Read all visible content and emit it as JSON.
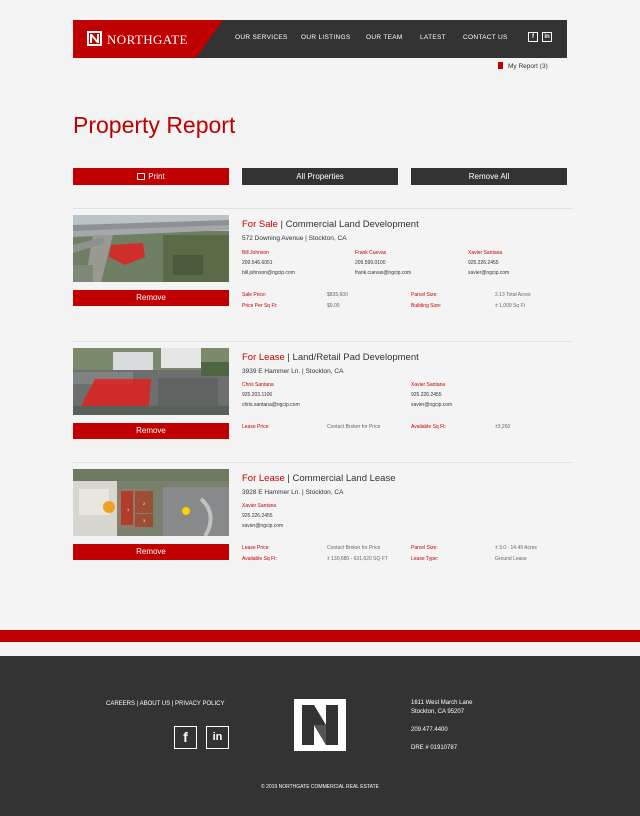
{
  "brand": {
    "name": "NORTHGATE",
    "red": "#c00000",
    "dark": "#333333"
  },
  "nav": {
    "items": [
      "OUR SERVICES",
      "OUR LISTINGS",
      "OUR TEAM",
      "LATEST",
      "CONTACT US"
    ],
    "social": [
      "f",
      "in"
    ]
  },
  "my_report": "My Report (3)",
  "page_title": "Property Report",
  "actions": {
    "print": "Print",
    "all_properties": "All Properties",
    "remove_all": "Remove All"
  },
  "properties": [
    {
      "status": "For Sale",
      "type": "Commercial Land Development",
      "address": "572 Downing Avenue | Stockton, CA",
      "agents": [
        {
          "name": "Bill Johnson",
          "phone": "209.546.6051",
          "email": "bill.johnson@ngcip.com"
        },
        {
          "name": "Frank Cuevas",
          "phone": "209.599.0100",
          "email": "frank.cuevas@ngcip.com"
        },
        {
          "name": "Xavier Santana",
          "phone": "925.226.2455",
          "email": "xavier@ngcip.com"
        }
      ],
      "details": [
        {
          "label": "Sale Price:",
          "value": "$835,600"
        },
        {
          "label": "Parcel Size:",
          "value": "2.13 Total Acres"
        },
        {
          "label": "Price Per Sq Ft:",
          "value": "$9.00"
        },
        {
          "label": "Building Size:",
          "value": "± 1,009 Sq Ft"
        }
      ],
      "remove": "Remove"
    },
    {
      "status": "For Lease",
      "type": "Land/Retail Pad Development",
      "address": "3939 E Hammer Ln. | Stockton, CA",
      "agents": [
        {
          "name": "Chris Santana",
          "phone": "925.203.1106",
          "email": "chris.santana@ngcip.com"
        },
        {
          "name": "Xavier Santana",
          "phone": "925.226.2455",
          "email": "xavier@ngcip.com"
        }
      ],
      "details": [
        {
          "label": "Lease Price:",
          "value": "Contact Broker for Price"
        },
        {
          "label": "Available Sq Ft:",
          "value": "±3,260"
        }
      ],
      "remove": "Remove"
    },
    {
      "status": "For Lease",
      "type": "Commercial Land Lease",
      "address": "3928 E Hammer Ln. | Stockton, CA",
      "agents": [
        {
          "name": "Xavier Santana",
          "phone": "925.226.2455",
          "email": "xavier@ngcip.com"
        }
      ],
      "details": [
        {
          "label": "Lease Price:",
          "value": "Contact Broker for Price"
        },
        {
          "label": "Parcel Size:",
          "value": "± 3.0 - 14.49 Acres"
        },
        {
          "label": "Available Sq Ft:",
          "value": "± 130,680 - 631,620 SQ FT"
        },
        {
          "label": "Lease Type:",
          "value": "Ground Lease"
        }
      ],
      "remove": "Remove",
      "lot_labels": [
        "1",
        "2",
        "3"
      ]
    }
  ],
  "footer": {
    "links": "CAREERS | ABOUT US | PRIVACY POLICY",
    "social": [
      "f",
      "in"
    ],
    "address_line1": "1611 West March Lane",
    "address_line2": "Stockton, CA 95207",
    "phone": "209.477.4400",
    "dre": "DRE # 01910787",
    "copyright": "© 2019 NORTHGATE COMMERCIAL REAL ESTATE"
  }
}
